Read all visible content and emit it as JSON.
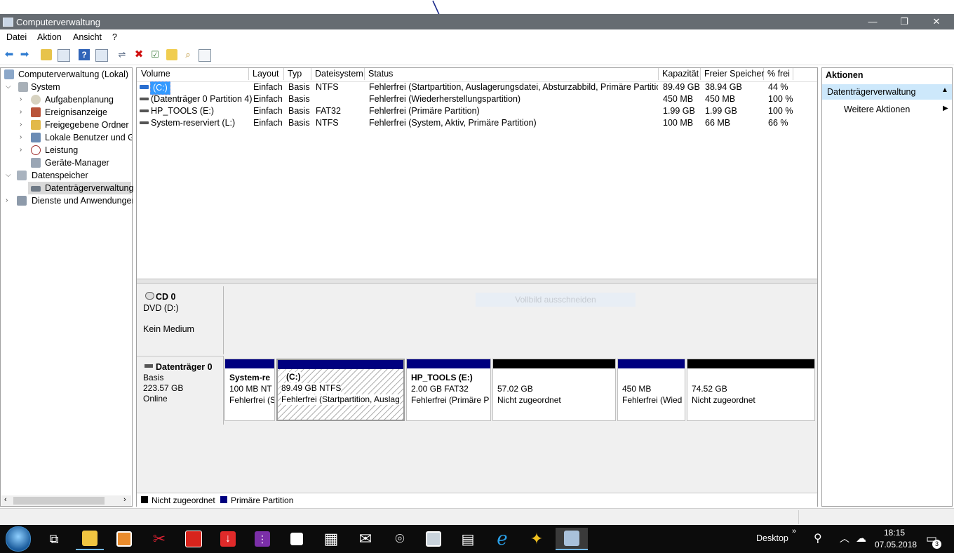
{
  "window": {
    "title": "Computerverwaltung",
    "minimize": "—",
    "restore": "❐",
    "close": "✕"
  },
  "menu": [
    "Datei",
    "Aktion",
    "Ansicht",
    "?"
  ],
  "tree": {
    "root": "Computerverwaltung (Lokal)",
    "system": "System",
    "system_children": [
      "Aufgabenplanung",
      "Ereignisanzeige",
      "Freigegebene Ordner",
      "Lokale Benutzer und Gruppen",
      "Leistung",
      "Geräte-Manager"
    ],
    "storage": "Datenspeicher",
    "storage_children": [
      "Datenträgerverwaltung"
    ],
    "services": "Dienste und Anwendungen"
  },
  "volumes": {
    "columns": [
      "Volume",
      "Layout",
      "Typ",
      "Dateisystem",
      "Status",
      "Kapazität",
      "Freier Speicher",
      "% frei"
    ],
    "rows": [
      [
        "(C:)",
        "Einfach",
        "Basis",
        "NTFS",
        "Fehlerfrei (Startpartition, Auslagerungsdatei, Absturzabbild, Primäre Partition)",
        "89.49 GB",
        "38.94 GB",
        "44 %"
      ],
      [
        "(Datenträger 0 Partition 4)",
        "Einfach",
        "Basis",
        "",
        "Fehlerfrei (Wiederherstellungspartition)",
        "450 MB",
        "450 MB",
        "100 %"
      ],
      [
        "HP_TOOLS (E:)",
        "Einfach",
        "Basis",
        "FAT32",
        "Fehlerfrei (Primäre Partition)",
        "1.99 GB",
        "1.99 GB",
        "100 %"
      ],
      [
        "System-reserviert (L:)",
        "Einfach",
        "Basis",
        "NTFS",
        "Fehlerfrei (System, Aktiv, Primäre Partition)",
        "100 MB",
        "66 MB",
        "66 %"
      ]
    ]
  },
  "cd": {
    "name": "CD 0",
    "drive": "DVD (D:)",
    "media": "Kein Medium",
    "overlay": "Vollbild ausschneiden"
  },
  "disk0": {
    "name": "Datenträger 0",
    "type": "Basis",
    "size": "223.57 GB",
    "state": "Online",
    "partitions": [
      {
        "title": "System-re",
        "line1": "100 MB NT",
        "line2": "Fehlerfrei (S",
        "kind": "primary"
      },
      {
        "title": "(C:)",
        "line1": "89.49 GB NTFS",
        "line2": "Fehlerfrei (Startpartition, Auslag",
        "kind": "primary-selected"
      },
      {
        "title": "HP_TOOLS  (E:)",
        "line1": "2.00 GB FAT32",
        "line2": "Fehlerfrei (Primäre P",
        "kind": "primary"
      },
      {
        "title": "",
        "line1": "57.02 GB",
        "line2": "Nicht zugeordnet",
        "kind": "unallocated"
      },
      {
        "title": "",
        "line1": "450 MB",
        "line2": "Fehlerfrei (Wied",
        "kind": "primary"
      },
      {
        "title": "",
        "line1": "74.52 GB",
        "line2": "Nicht zugeordnet",
        "kind": "unallocated"
      }
    ]
  },
  "legend": {
    "unallocated": "Nicht zugeordnet",
    "primary": "Primäre Partition",
    "unallocated_color": "#000000",
    "primary_color": "#00007f"
  },
  "actions": {
    "header": "Aktionen",
    "section": "Datenträgerverwaltung",
    "more": "Weitere Aktionen"
  },
  "taskbar": {
    "desktop": "Desktop",
    "time": "18:15",
    "date": "07.05.2018",
    "notifications": "3"
  },
  "colors": {
    "titlebar": "#666c72",
    "primary_bar": "#00007f",
    "unallocated_bar": "#000000",
    "selection": "#3399ff",
    "actions_section_bg": "#cde8fb"
  }
}
